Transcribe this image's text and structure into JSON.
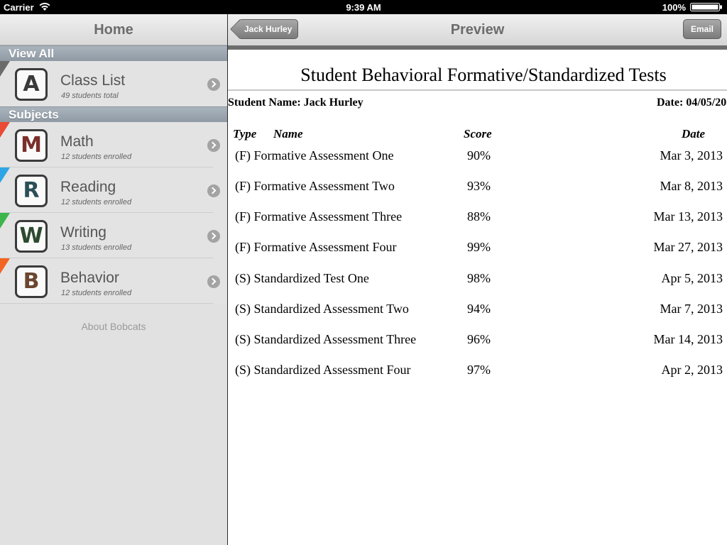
{
  "status_bar": {
    "carrier": "Carrier",
    "time": "9:39 AM",
    "battery": "100%"
  },
  "sidebar": {
    "title": "Home",
    "view_all_header": "View All",
    "class_list": {
      "letter": "A",
      "name": "Class List",
      "subtitle": "49 students total",
      "corner_color": "#6b6b6b",
      "letter_color": "#3a3a3a"
    },
    "subjects_header": "Subjects",
    "subjects": [
      {
        "letter": "M",
        "name": "Math",
        "subtitle": "12 students enrolled",
        "corner_color": "#e94b35",
        "letter_color": "#7a2f2a"
      },
      {
        "letter": "R",
        "name": "Reading",
        "subtitle": "12 students enrolled",
        "corner_color": "#2ea6e6",
        "letter_color": "#2a4f58"
      },
      {
        "letter": "W",
        "name": "Writing",
        "subtitle": "13 students enrolled",
        "corner_color": "#3cb54a",
        "letter_color": "#2d4a2f"
      },
      {
        "letter": "B",
        "name": "Behavior",
        "subtitle": "12 students enrolled",
        "corner_color": "#f26522",
        "letter_color": "#6a4630"
      }
    ],
    "about": "About Bobcats"
  },
  "preview": {
    "back_label": "Jack Hurley",
    "title": "Preview",
    "email_label": "Email"
  },
  "document": {
    "title": "Student Behavioral Formative/Standardized Tests",
    "student": "Student Name: Jack Hurley",
    "date": "Date: 04/05/20",
    "headers": {
      "type": "Type",
      "name": "Name",
      "score": "Score",
      "date": "Date"
    },
    "rows": [
      {
        "name": "(F) Formative Assessment One",
        "score": "90%",
        "date": "Mar 3, 2013"
      },
      {
        "name": "(F) Formative Assessment Two",
        "score": "93%",
        "date": "Mar 8, 2013"
      },
      {
        "name": "(F) Formative Assessment Three",
        "score": "88%",
        "date": "Mar 13, 2013"
      },
      {
        "name": "(F) Formative Assessment Four",
        "score": "99%",
        "date": "Mar 27, 2013"
      },
      {
        "name": "(S) Standardized Test One",
        "score": "98%",
        "date": "Apr 5, 2013"
      },
      {
        "name": "(S) Standardized Assessment Two",
        "score": "94%",
        "date": "Mar 7, 2013"
      },
      {
        "name": "(S) Standardized Assessment Three",
        "score": "96%",
        "date": "Mar 14, 2013"
      },
      {
        "name": "(S) Standardized Assessment Four",
        "score": "97%",
        "date": "Apr 2, 2013"
      }
    ]
  }
}
